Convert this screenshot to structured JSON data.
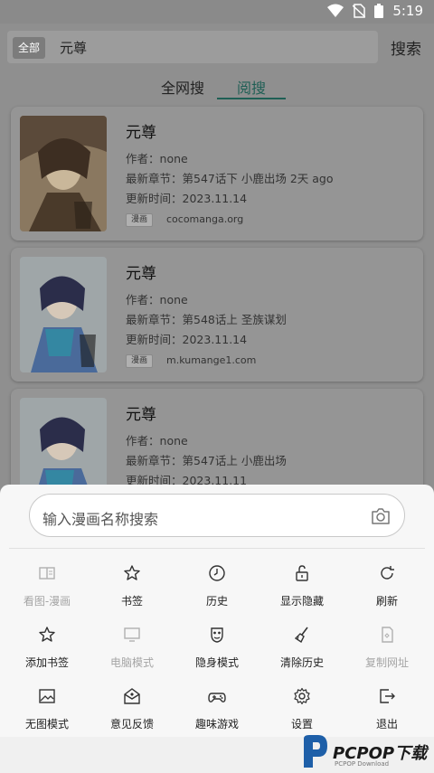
{
  "status_bar": {
    "time": "5:19"
  },
  "header": {
    "scope_label": "全部",
    "query": "元尊",
    "search_button": "搜索",
    "tabs": [
      {
        "label": "全网搜",
        "active": false
      },
      {
        "label": "阅搜",
        "active": true
      }
    ],
    "accent_color": "#1f5f55"
  },
  "results": [
    {
      "title": "元尊",
      "author_label": "作者：",
      "author": "none",
      "latest_label": "最新章节：",
      "latest": "第547话下 小鹿出场 2天 ago",
      "updated_label": "更新时间：",
      "updated": "2023.11.14",
      "tag": "漫画",
      "site": "cocomanga.org"
    },
    {
      "title": "元尊",
      "author_label": "作者：",
      "author": "none",
      "latest_label": "最新章节：",
      "latest": "第548话上 圣族谋划",
      "updated_label": "更新时间：",
      "updated": "2023.11.14",
      "tag": "漫画",
      "site": "m.kumange1.com"
    },
    {
      "title": "元尊",
      "author_label": "作者：",
      "author": "none",
      "latest_label": "最新章节：",
      "latest": "第547话上 小鹿出场",
      "updated_label": "更新时间：",
      "updated": "2023.11.11"
    }
  ],
  "sheet": {
    "search_placeholder": "输入漫画名称搜索",
    "menu": [
      {
        "label": "看图-漫画",
        "icon": "book-icon",
        "enabled": false
      },
      {
        "label": "书签",
        "icon": "star-icon",
        "enabled": true
      },
      {
        "label": "历史",
        "icon": "clock-icon",
        "enabled": true
      },
      {
        "label": "显示隐藏",
        "icon": "unlock-icon",
        "enabled": true
      },
      {
        "label": "刷新",
        "icon": "refresh-icon",
        "enabled": true
      },
      {
        "label": "添加书签",
        "icon": "star-plus-icon",
        "enabled": true
      },
      {
        "label": "电脑模式",
        "icon": "monitor-icon",
        "enabled": false
      },
      {
        "label": "隐身模式",
        "icon": "mask-icon",
        "enabled": true
      },
      {
        "label": "清除历史",
        "icon": "broom-icon",
        "enabled": true
      },
      {
        "label": "复制网址",
        "icon": "copy-icon",
        "enabled": false
      },
      {
        "label": "无图模式",
        "icon": "image-icon",
        "enabled": true
      },
      {
        "label": "意见反馈",
        "icon": "feedback-icon",
        "enabled": true
      },
      {
        "label": "趣味游戏",
        "icon": "gamepad-icon",
        "enabled": true
      },
      {
        "label": "设置",
        "icon": "gear-icon",
        "enabled": true
      },
      {
        "label": "退出",
        "icon": "exit-icon",
        "enabled": true
      }
    ]
  },
  "watermark": {
    "brand": "PCPOP下载",
    "sub": "PCPOP Download"
  }
}
